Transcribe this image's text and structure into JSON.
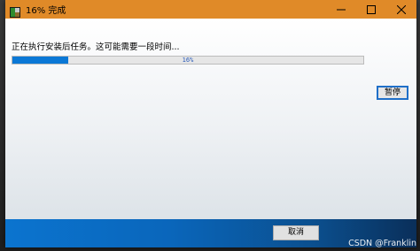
{
  "window": {
    "title": "16% 完成",
    "accent_color": "#e08a28"
  },
  "main": {
    "status_text": "正在执行安装后任务。这可能需要一段时间...",
    "progress": {
      "percent": 16,
      "label": "16%",
      "fill_color": "#0b78d6"
    },
    "pause_label": "暂停"
  },
  "footer": {
    "cancel_label": "取消"
  },
  "watermark": {
    "text": "CSDN @Franklin"
  },
  "icons": {
    "app": "installer-icon",
    "minimize": "minimize-icon",
    "maximize": "maximize-icon",
    "close": "close-icon"
  }
}
